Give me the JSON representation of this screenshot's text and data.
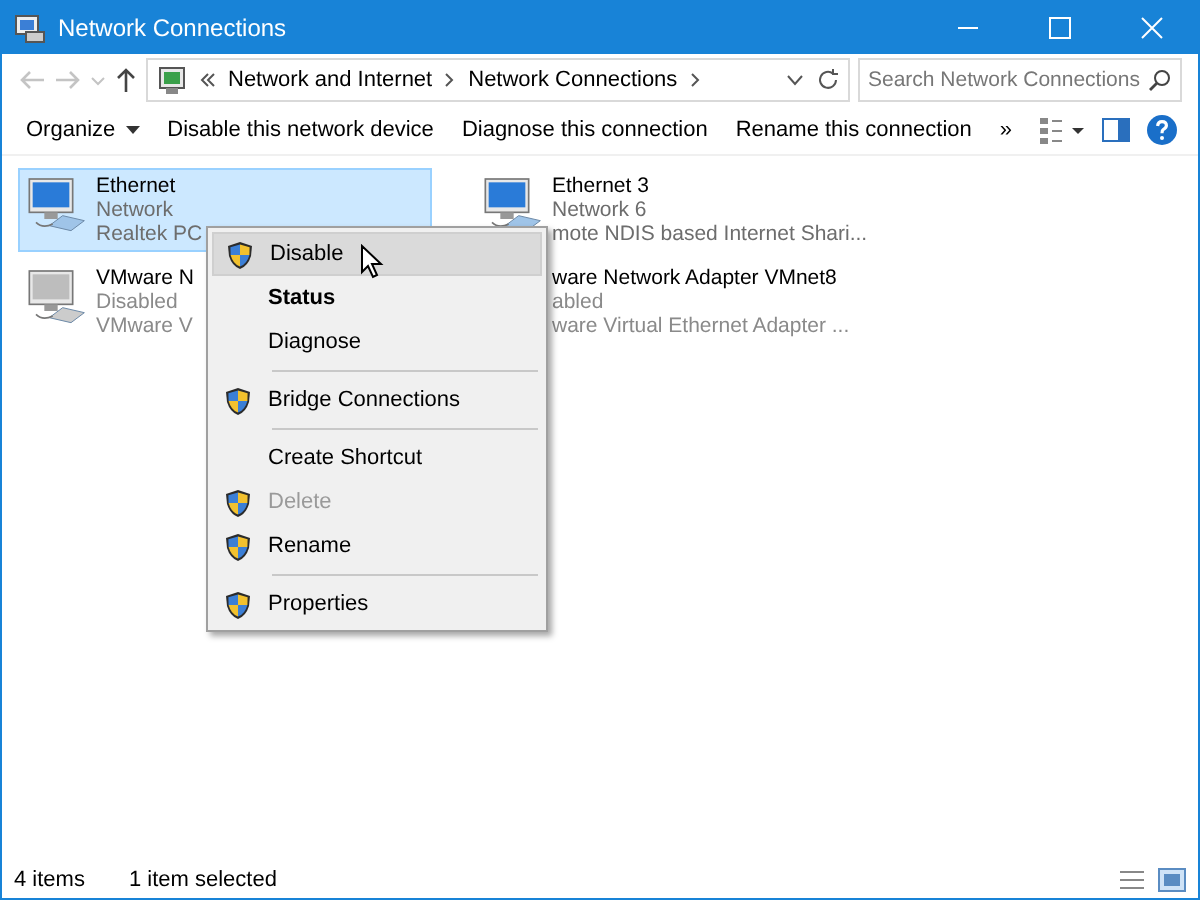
{
  "window": {
    "title": "Network Connections"
  },
  "address_bar": {
    "path": [
      {
        "label": "Network and Internet"
      },
      {
        "label": "Network Connections"
      }
    ]
  },
  "search": {
    "placeholder": "Search Network Connections"
  },
  "toolbar": {
    "buttons": [
      {
        "label": "Organize",
        "kind": "dropdown"
      },
      {
        "label": "Disable this network device",
        "kind": "plain"
      },
      {
        "label": "Diagnose this connection",
        "kind": "plain"
      },
      {
        "label": "Rename this connection",
        "kind": "plain"
      },
      {
        "label": "»",
        "kind": "plain"
      }
    ]
  },
  "connections": [
    {
      "name": "Ethernet",
      "lines": [
        "Network",
        "Realtek PC"
      ],
      "selected": true,
      "disabled": false,
      "icon": true
    },
    {
      "name": "Ethernet 3",
      "lines": [
        "Network 6",
        "mote NDIS based Internet Shari..."
      ],
      "selected": false,
      "disabled": false,
      "icon": true
    },
    {
      "name": "VMware N",
      "lines": [
        "Disabled",
        "VMware V"
      ],
      "selected": false,
      "disabled": true,
      "icon": true
    },
    {
      "name": "ware Network Adapter VMnet8",
      "lines": [
        "abled",
        "ware Virtual Ethernet Adapter ..."
      ],
      "selected": false,
      "disabled": true,
      "icon": false
    }
  ],
  "context_menu": {
    "items": [
      {
        "kind": "item",
        "label": "Disable",
        "shield": true,
        "bold": false,
        "disabled": false,
        "selected": true
      },
      {
        "kind": "item",
        "label": "Status",
        "shield": false,
        "bold": true,
        "disabled": false,
        "selected": false
      },
      {
        "kind": "item",
        "label": "Diagnose",
        "shield": false,
        "bold": false,
        "disabled": false,
        "selected": false
      },
      {
        "kind": "separator"
      },
      {
        "kind": "item",
        "label": "Bridge Connections",
        "shield": true,
        "bold": false,
        "disabled": false,
        "selected": false
      },
      {
        "kind": "separator"
      },
      {
        "kind": "item",
        "label": "Create Shortcut",
        "shield": false,
        "bold": false,
        "disabled": false,
        "selected": false
      },
      {
        "kind": "item",
        "label": "Delete",
        "shield": true,
        "bold": false,
        "disabled": true,
        "selected": false
      },
      {
        "kind": "item",
        "label": "Rename",
        "shield": true,
        "bold": false,
        "disabled": false,
        "selected": false
      },
      {
        "kind": "separator"
      },
      {
        "kind": "item",
        "label": "Properties",
        "shield": true,
        "bold": false,
        "disabled": false,
        "selected": false
      }
    ]
  },
  "status_bar": {
    "item_count": "4 items",
    "selection": "1 item selected"
  }
}
